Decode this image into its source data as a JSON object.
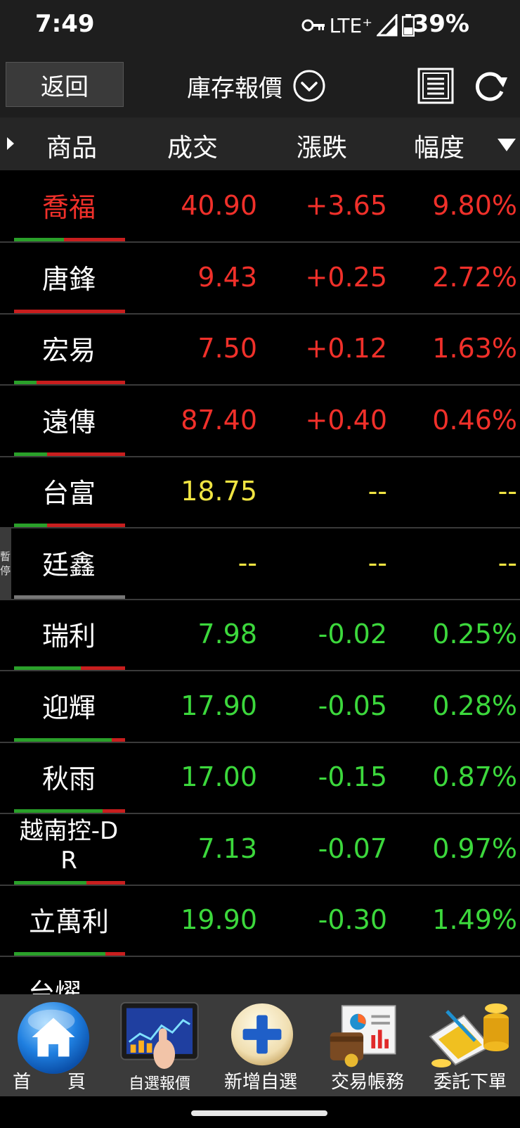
{
  "status_bar": {
    "time": "7:49",
    "network": "LTE⁺",
    "battery": "39%",
    "icons": [
      "vpn-key-icon",
      "signal-icon",
      "battery-icon"
    ]
  },
  "toolbar": {
    "back_label": "返回",
    "title": "庫存報價",
    "icons": [
      "chevron-down-circle-icon",
      "list-icon",
      "refresh-icon"
    ]
  },
  "columns": {
    "name": "商品",
    "price": "成交",
    "change": "漲跌",
    "percent": "幅度"
  },
  "rows": [
    {
      "name": "喬福",
      "price": "40.90",
      "change": "+3.65",
      "percent": "9.80%",
      "trend": "up",
      "bar_green": 0.45,
      "name_color": "#f0302a"
    },
    {
      "name": "唐鋒",
      "price": "9.43",
      "change": "+0.25",
      "percent": "2.72%",
      "trend": "up",
      "bar_green": 0.0
    },
    {
      "name": "宏易",
      "price": "7.50",
      "change": "+0.12",
      "percent": "1.63%",
      "trend": "up",
      "bar_green": 0.2
    },
    {
      "name": "遠傳",
      "price": "87.40",
      "change": "+0.40",
      "percent": "0.46%",
      "trend": "up",
      "bar_green": 0.3
    },
    {
      "name": "台富",
      "price": "18.75",
      "change": "--",
      "percent": "--",
      "trend": "flat",
      "bar_green": 0.3
    },
    {
      "name": "廷鑫",
      "price": "--",
      "change": "--",
      "percent": "--",
      "trend": "flat",
      "bar_green": null,
      "suspended": "暫停"
    },
    {
      "name": "瑞利",
      "price": "7.98",
      "change": "-0.02",
      "percent": "0.25%",
      "trend": "down",
      "bar_green": 0.6
    },
    {
      "name": "迎輝",
      "price": "17.90",
      "change": "-0.05",
      "percent": "0.28%",
      "trend": "down",
      "bar_green": 0.88
    },
    {
      "name": "秋雨",
      "price": "17.00",
      "change": "-0.15",
      "percent": "0.87%",
      "trend": "down",
      "bar_green": 0.8
    },
    {
      "name": "越南控-DR",
      "name_line1": "越南控-D",
      "name_line2": "R",
      "price": "7.13",
      "change": "-0.07",
      "percent": "0.97%",
      "trend": "down",
      "bar_green": 0.65
    },
    {
      "name": "立萬利",
      "price": "19.90",
      "change": "-0.30",
      "percent": "1.49%",
      "trend": "down",
      "bar_green": 0.82
    }
  ],
  "partial_next_row": "台燿",
  "bottom_nav": [
    {
      "label": "首　　頁",
      "icon": "home-icon"
    },
    {
      "label": "自選報價",
      "icon": "tablet-chart-icon"
    },
    {
      "label": "新增自選",
      "icon": "plus-circle-icon"
    },
    {
      "label": "交易帳務",
      "icon": "wallet-chart-icon"
    },
    {
      "label": "委託下單",
      "icon": "coins-order-icon"
    }
  ],
  "colors": {
    "up": "#f0302a",
    "down": "#3cd83c",
    "flat": "#f0e442",
    "bar_green": "#2aa02a",
    "bar_red": "#c81e1e"
  }
}
